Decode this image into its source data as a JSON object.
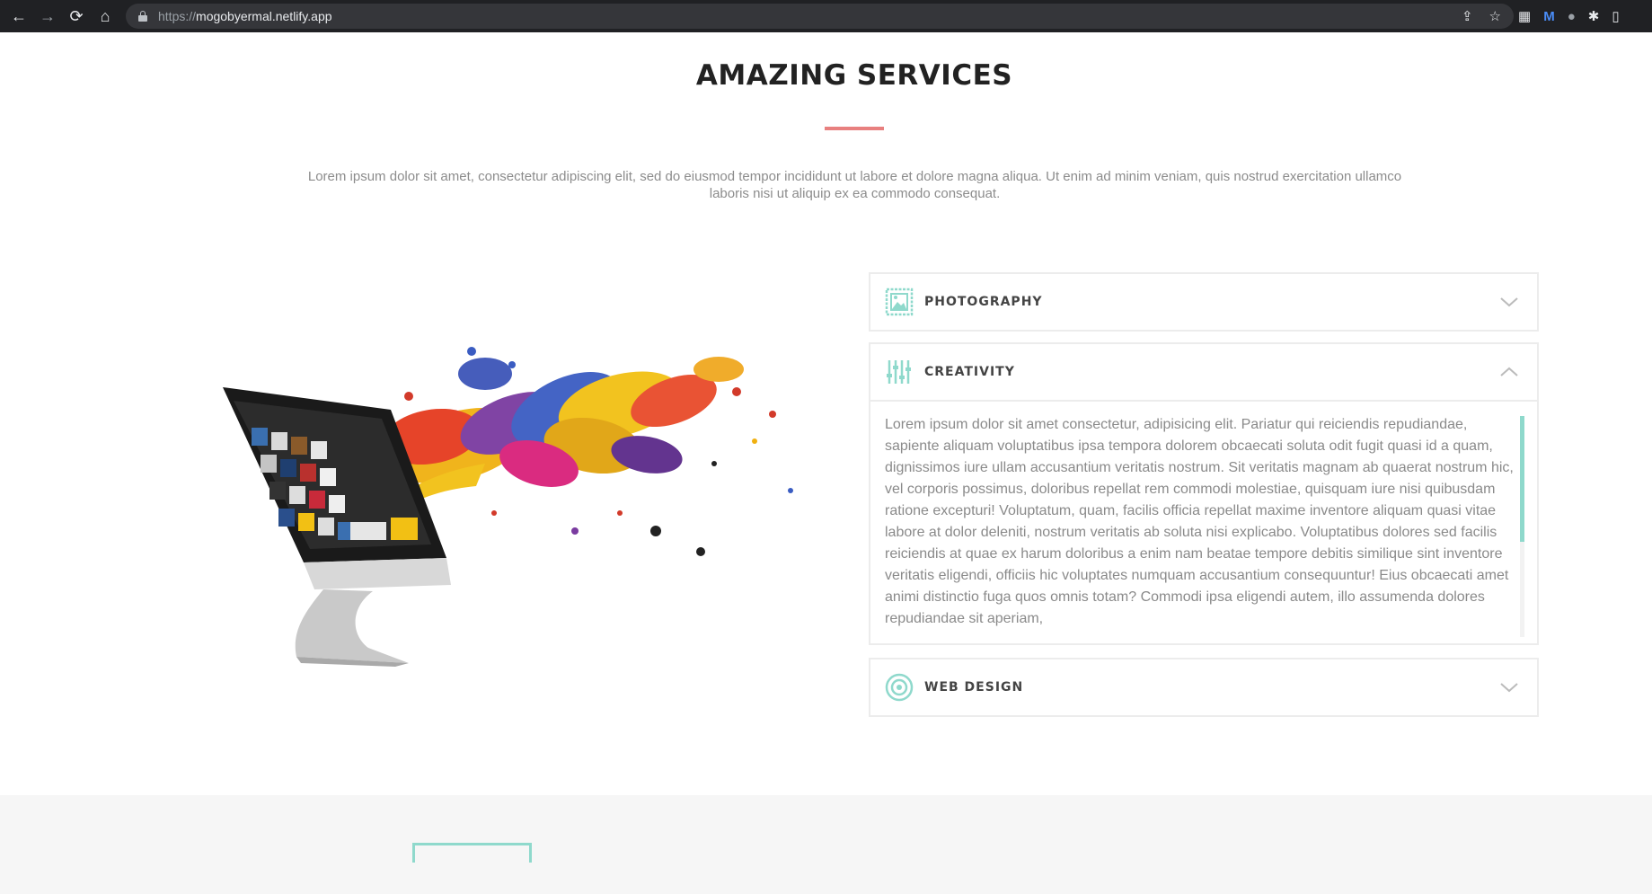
{
  "browser": {
    "url_scheme": "https://",
    "url_host": "mogobyermal.netlify.app",
    "back_glyph": "←",
    "forward_glyph": "→",
    "reload_glyph": "⟳",
    "home_glyph": "⌂",
    "share_glyph": "⇪",
    "star_glyph": "☆",
    "ext_glyphs": [
      "▦",
      "M",
      "●",
      "✱",
      "▯"
    ]
  },
  "section": {
    "title": "AMAZING SERVICES",
    "intro": "Lorem ipsum dolor sit amet, consectetur adipiscing elit, sed do eiusmod tempor incididunt ut labore et dolore magna aliqua. Ut enim ad minim veniam, quis nostrud exercitation ullamco laboris nisi ut aliquip ex ea commodo consequat.",
    "accent_color": "#e8807f",
    "icon_color": "#8fd9cc"
  },
  "accordion": {
    "items": [
      {
        "title": "PHOTOGRAPHY",
        "icon": "image-icon",
        "expanded": false
      },
      {
        "title": "CREATIVITY",
        "icon": "sliders-icon",
        "expanded": true,
        "body": "Lorem ipsum dolor sit amet consectetur, adipisicing elit. Pariatur qui reiciendis repudiandae, sapiente aliquam voluptatibus ipsa tempora dolorem obcaecati soluta odit fugit quasi id a quam, dignissimos iure ullam accusantium veritatis nostrum. Sit veritatis magnam ab quaerat nostrum hic, vel corporis possimus, doloribus repellat rem commodi molestiae, quisquam iure nisi quibusdam ratione excepturi! Voluptatum, quam, facilis officia repellat maxime inventore aliquam quasi vitae labore at dolor deleniti, nostrum veritatis ab soluta nisi explicabo. Voluptatibus dolores sed facilis reiciendis at quae ex harum doloribus a enim nam beatae tempore debitis similique sint inventore veritatis eligendi, officiis hic voluptates numquam accusantium consequuntur! Eius obcaecati amet animi distinctio fuga quos omnis totam? Commodi ipsa eligendi autem, illo assumenda dolores repudiandae sit aperiam,"
      },
      {
        "title": "WEB DESIGN",
        "icon": "target-icon",
        "expanded": false
      }
    ]
  }
}
